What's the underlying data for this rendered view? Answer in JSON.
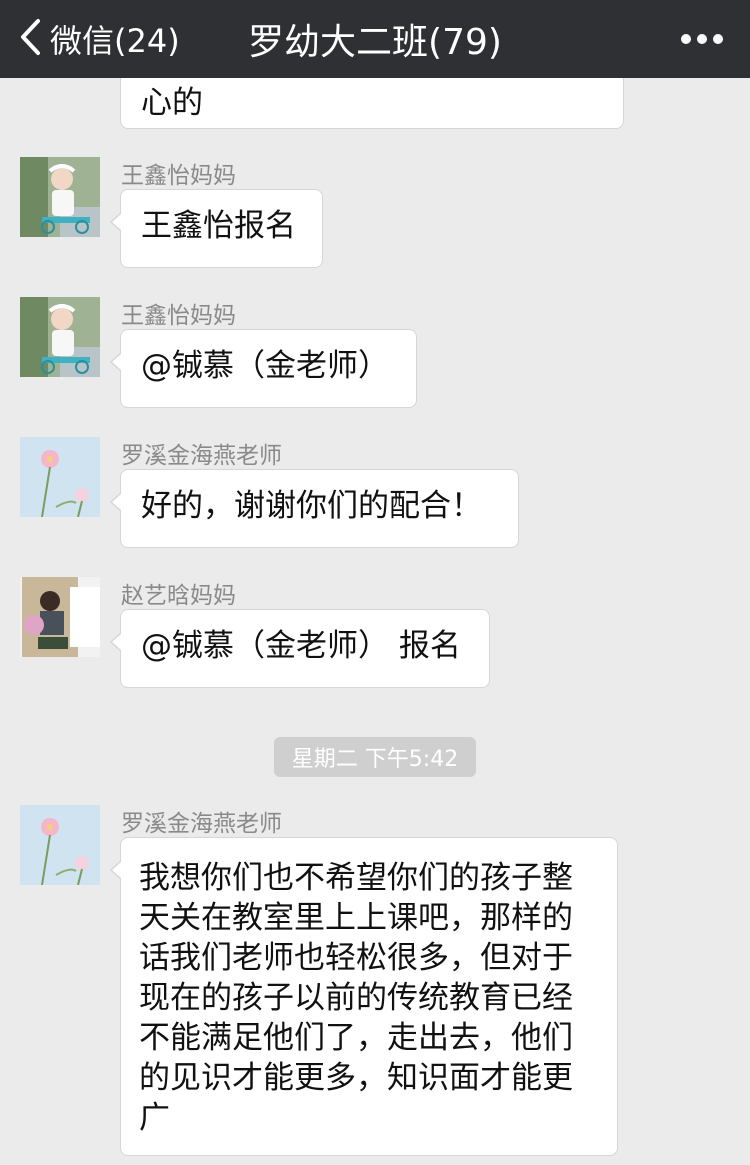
{
  "header": {
    "back_label": "微信(24)",
    "title": "罗幼大二班(79)"
  },
  "messages": [
    {
      "sender": "",
      "text": "心的"
    },
    {
      "sender": "王鑫怡妈妈",
      "text": "王鑫怡报名"
    },
    {
      "sender": "王鑫怡妈妈",
      "text": "@铖慕（金老师）"
    },
    {
      "sender": "罗溪金海燕老师",
      "text": "好的，谢谢你们的配合！"
    },
    {
      "sender": "赵艺晗妈妈",
      "text": "@铖慕（金老师） 报名"
    },
    {
      "sender": "罗溪金海燕老师",
      "lines": [
        "我想你们也不希望你们的孩子整",
        "天关在教室里上上课吧，那样的",
        "话我们老师也轻松很多，但对于",
        "现在的孩子以前的传统教育已经",
        "不能满足他们了，走出去，他们",
        "的见识才能更多，知识面才能更",
        "广"
      ]
    }
  ],
  "timestamp": "星期二 下午5:42"
}
